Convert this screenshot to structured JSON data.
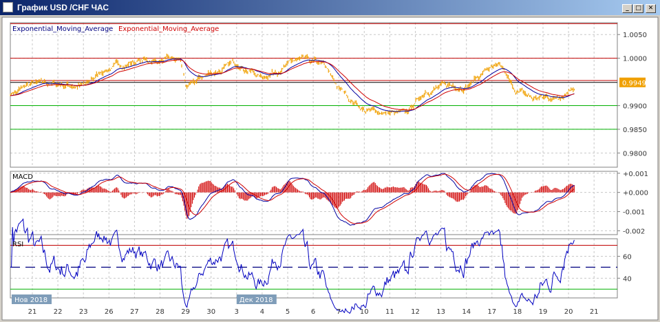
{
  "window": {
    "title": "График USD /CHF  ЧАС",
    "buttons": [
      "_",
      "□",
      "✕"
    ]
  },
  "legend": {
    "ema1": "Exponential_Moving_Average",
    "ema2": "Exponential_Moving_Average"
  },
  "colors": {
    "candle": "#f0a000",
    "ema_fast": "#0000a0",
    "ema_slow": "#d00000",
    "level_red": "#c00000",
    "level_green": "#00b000",
    "macd_hist": "#d00000"
  },
  "chart_data": [
    {
      "type": "line",
      "title": "USD/CHF price",
      "ylim": [
        0.977,
        1.0075
      ],
      "y_ticks": [
        "1.0050",
        "1.0000",
        "0.9900",
        "0.9850",
        "0.9800"
      ],
      "y_tick_values": [
        1.005,
        1.0,
        0.99,
        0.985,
        0.98
      ],
      "current_price": "0.9949",
      "levels": {
        "red": [
          1.0073,
          1.0,
          0.9953
        ],
        "green": [
          0.99,
          0.985
        ],
        "current": 0.9949
      },
      "price_path": {
        "t": [
          -0.86,
          0,
          1.1,
          2.1,
          2.78,
          4.12,
          5.8,
          6.06,
          6.82,
          8.06,
          8.98,
          10.32,
          11.4,
          12.0,
          13.02,
          13.99,
          14.64,
          15.44,
          17.06,
          17.87,
          18.41,
          18.81,
          19.62,
          20.57,
          21.24
        ],
        "price": [
          0.9925,
          0.9945,
          0.9945,
          0.9942,
          0.9975,
          0.9995,
          0.9995,
          0.9935,
          0.9965,
          0.999,
          0.996,
          0.9995,
          0.9985,
          0.9935,
          0.989,
          0.9885,
          0.988,
          0.9935,
          0.9945,
          0.998,
          0.9975,
          0.9935,
          0.9915,
          0.9918,
          0.9945
        ]
      },
      "x_labels": [
        "21",
        "22",
        "23",
        "26",
        "27",
        "28",
        "29",
        "30",
        "3",
        "4",
        "5",
        "6",
        "7",
        "10",
        "11",
        "12",
        "13",
        "14",
        "17",
        "18",
        "19",
        "20",
        "21"
      ],
      "month_labels": [
        {
          "label": "Нов 2018",
          "t": -0.9
        },
        {
          "label": "Дек 2018",
          "t": 8
        }
      ]
    },
    {
      "type": "bar",
      "title": "MACD",
      "ylim": [
        -0.0022,
        0.0011
      ],
      "y_ticks": [
        "+0.001",
        "+0.000",
        "-0.001",
        "-0.002"
      ],
      "y_tick_values": [
        0.001,
        0,
        -0.001,
        -0.002
      ]
    },
    {
      "type": "line",
      "title": "RSI",
      "ylim": [
        22,
        76
      ],
      "y_ticks": [
        "60",
        "40"
      ],
      "y_tick_values": [
        60,
        40
      ],
      "levels": {
        "upper": 70,
        "mid": 50,
        "lower": 30
      }
    }
  ]
}
